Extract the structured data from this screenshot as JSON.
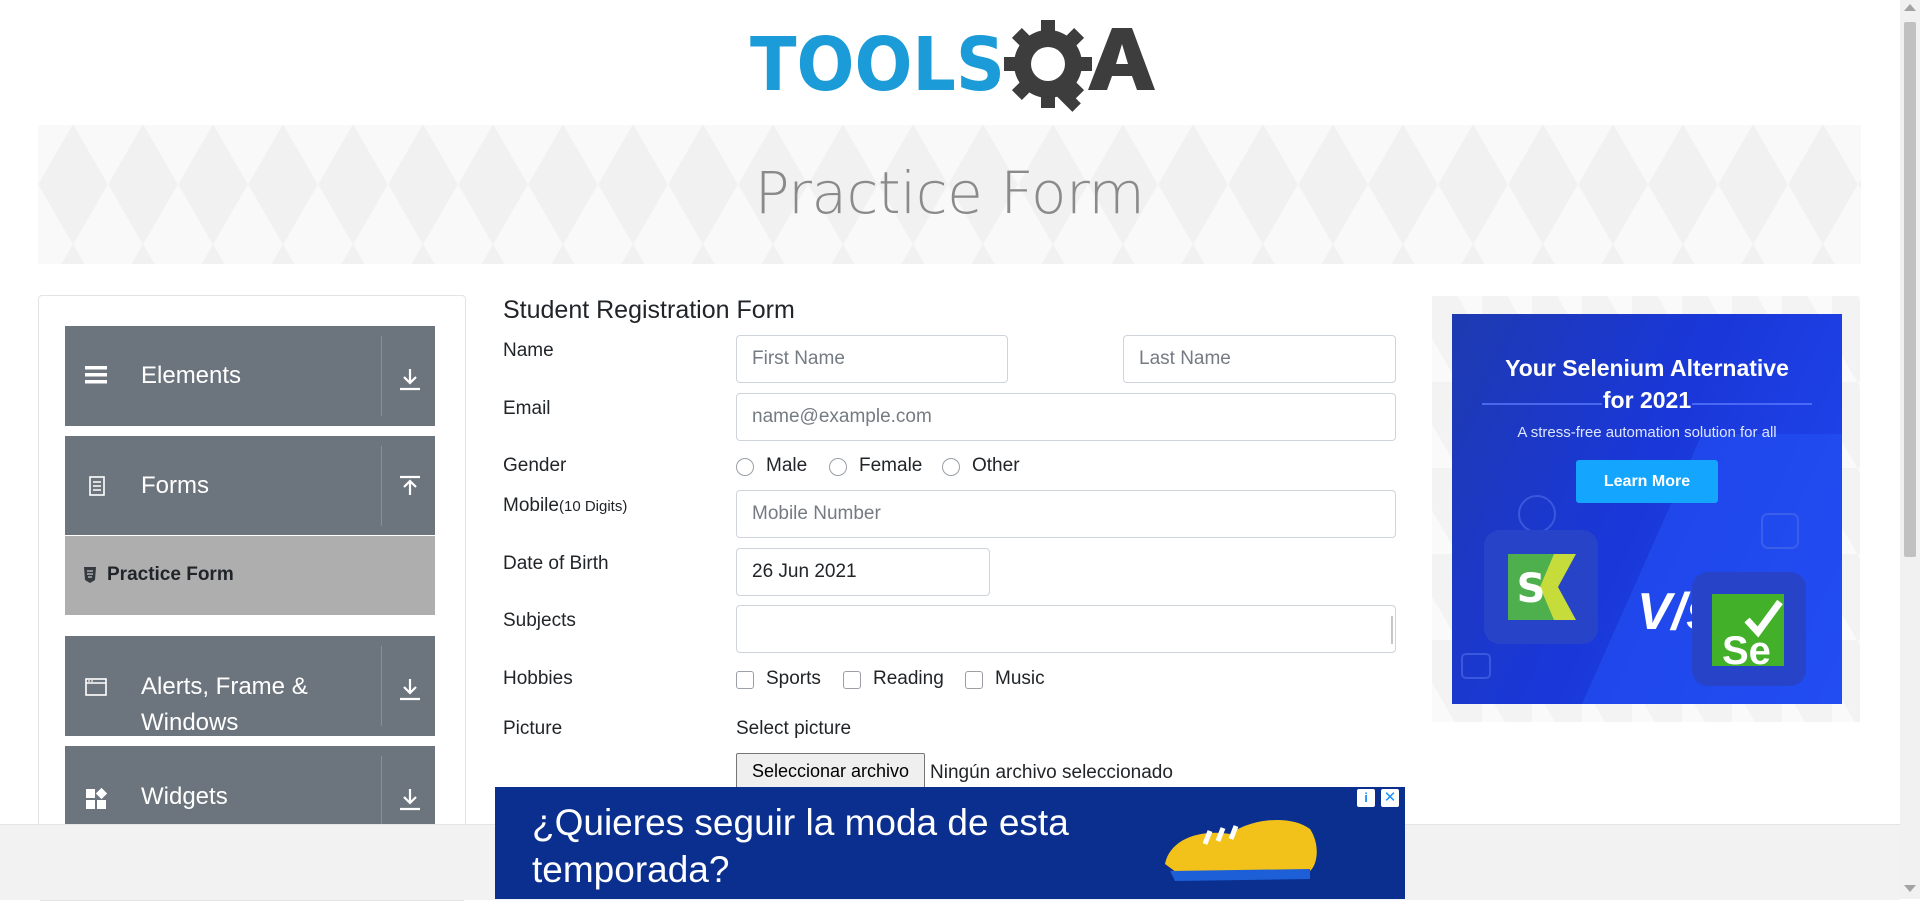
{
  "header": {
    "logo_text": "TOOLSQA"
  },
  "banner": {
    "title": "Practice Form"
  },
  "sidebar": {
    "groups": [
      {
        "title": "Elements",
        "icon": "hamburger-icon",
        "state": "collapsed"
      },
      {
        "title": "Forms",
        "icon": "document-icon",
        "state": "expanded"
      },
      {
        "title": "Alerts, Frame &",
        "title_line2": "Windows",
        "icon": "window-icon",
        "state": "collapsed"
      },
      {
        "title": "Widgets",
        "icon": "widgets-icon",
        "state": "collapsed"
      }
    ],
    "active_item": {
      "label": "Practice Form",
      "icon": "html5-icon"
    }
  },
  "form": {
    "title": "Student Registration Form",
    "name_label": "Name",
    "first_name_placeholder": "First Name",
    "last_name_placeholder": "Last Name",
    "email_label": "Email",
    "email_placeholder": "name@example.com",
    "gender_label": "Gender",
    "gender_options": [
      "Male",
      "Female",
      "Other"
    ],
    "mobile_label": "Mobile",
    "mobile_hint": "(10 Digits)",
    "mobile_placeholder": "Mobile Number",
    "dob_label": "Date of Birth",
    "dob_value": "26 Jun 2021",
    "subjects_label": "Subjects",
    "subjects_value": "",
    "hobbies_label": "Hobbies",
    "hobbies_options": [
      "Sports",
      "Reading",
      "Music"
    ],
    "picture_label": "Picture",
    "picture_select_label": "Select picture",
    "file_button": "Seleccionar archivo",
    "file_status": "Ningún archivo seleccionado"
  },
  "right_ad": {
    "headline_line1": "Your Selenium Alternative",
    "headline_line2": "for 2021",
    "subtitle": "A stress-free automation solution for all",
    "button": "Learn More",
    "vs_text": "V/s",
    "right_logo_text": "Se"
  },
  "bottom_ad": {
    "text": "¿Quieres seguir la moda de esta temporada?",
    "info": "i",
    "close": "✕"
  },
  "colors": {
    "brand_blue": "#1b9bd7",
    "brand_dark": "#3d3d3d",
    "sidebar_group": "#6c757d",
    "sidebar_active": "#aeaeae",
    "ad_blue": "#1a37d8",
    "bottom_ad": "#0b2f8e"
  }
}
